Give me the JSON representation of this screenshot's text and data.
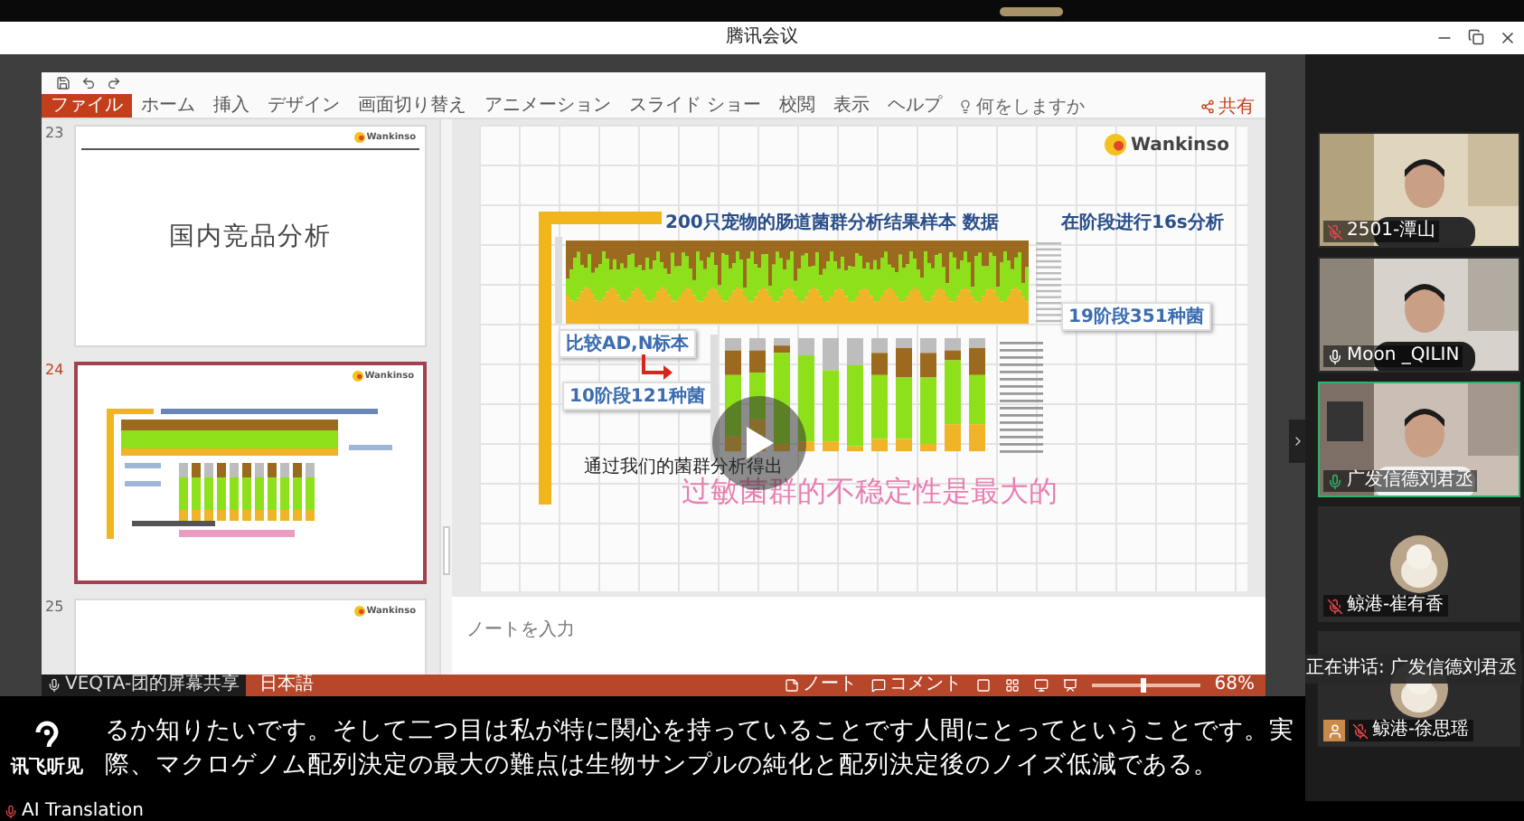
{
  "window": {
    "title": "腾讯会议"
  },
  "powerpoint": {
    "tabs": [
      {
        "label": "ファイル",
        "selected": true
      },
      {
        "label": "ホーム",
        "selected": false
      },
      {
        "label": "挿入",
        "selected": false
      },
      {
        "label": "デザイン",
        "selected": false
      },
      {
        "label": "画面切り替え",
        "selected": false
      },
      {
        "label": "アニメーション",
        "selected": false
      },
      {
        "label": "スライド ショー",
        "selected": false
      },
      {
        "label": "校閲",
        "selected": false
      },
      {
        "label": "表示",
        "selected": false
      },
      {
        "label": "ヘルプ",
        "selected": false
      }
    ],
    "tell_me": "何をしますか",
    "share": "共有",
    "thumbnails": [
      {
        "number": "23",
        "selected": false,
        "kind": "title",
        "logo": "Wankinso",
        "title": "国内竞品分析"
      },
      {
        "number": "24",
        "selected": true,
        "kind": "chart",
        "logo": "Wankinso"
      },
      {
        "number": "25",
        "selected": false,
        "kind": "partial",
        "logo": "Wankinso"
      }
    ],
    "slide": {
      "logo": "Wankinso",
      "title": "200只宠物的肠道菌群分析结果样本 数据",
      "subtitle": "在阶段进行16s分析",
      "label_top": "19阶段351种菌",
      "label_compare": "比较AD,N标本",
      "label_bottom": "10阶段121种菌",
      "caption": "通过我们的菌群分析得出",
      "highlight": "过敏菌群的不稳定性是最大的"
    },
    "notes": {
      "placeholder": "ノートを入力"
    },
    "status_bar": {
      "share_label": "VEQTA-团的屏幕共享",
      "language": "日本語",
      "notes": "ノート",
      "comments": "コメント",
      "zoom": {
        "level": 0.45
      },
      "zoom_label": "68%"
    }
  },
  "participants": [
    {
      "name": "2501-潭山",
      "kind": "video",
      "muted": true,
      "speaking": false
    },
    {
      "name": "Moon _QILIN",
      "kind": "video",
      "muted": false,
      "speaking": false
    },
    {
      "name": "广发信德刘君丞",
      "kind": "video",
      "muted": false,
      "speaking": true
    },
    {
      "name": "鲸港-崔有香",
      "kind": "avatar",
      "muted": true,
      "speaking": false
    },
    {
      "name": "鲸港-徐思瑶",
      "kind": "avatar",
      "muted": true,
      "speaking": false
    }
  ],
  "speaking_notice": "正在讲话: 广发信德刘君丞",
  "subtitles": {
    "brand": "讯飞听见",
    "lines": [
      "るか知りたいです。そして二つ目は私が特に関心を持っていることです人間にとってということです。実",
      "際、マクロゲノム配列決定の最大の難点は生物サンプルの純化と配列決定後のノイズ低減である。"
    ]
  },
  "footer": {
    "label": "AI Translation"
  }
}
